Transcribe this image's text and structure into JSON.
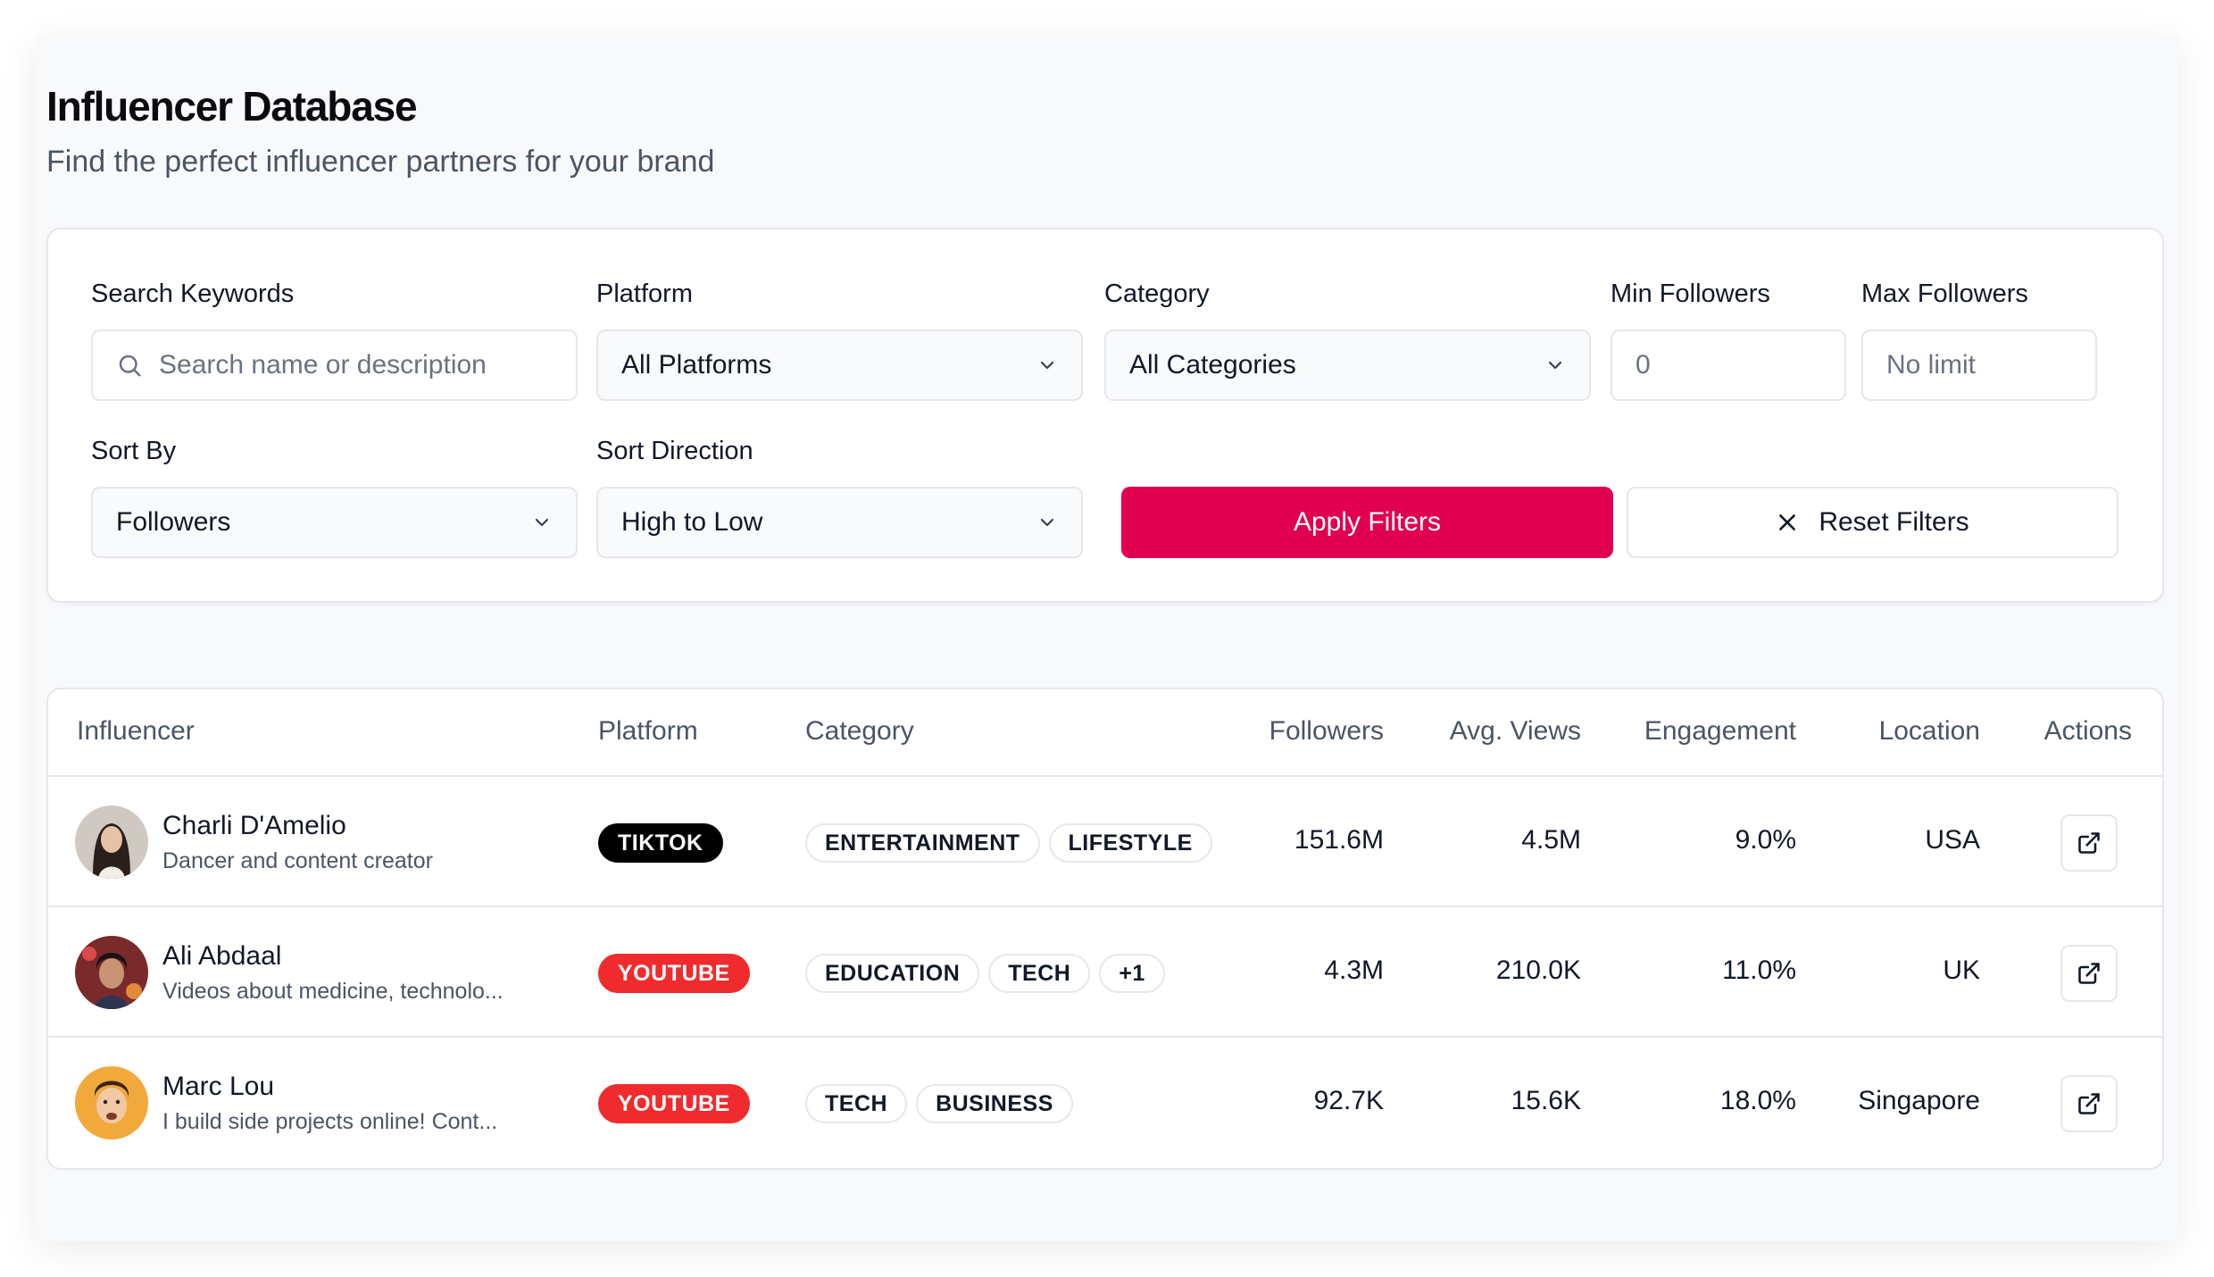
{
  "header": {
    "title": "Influencer Database",
    "subtitle": "Find the perfect influencer partners for your brand"
  },
  "filters": {
    "search": {
      "label": "Search Keywords",
      "placeholder": "Search name or description"
    },
    "platform": {
      "label": "Platform",
      "value": "All Platforms"
    },
    "category": {
      "label": "Category",
      "value": "All Categories"
    },
    "min_followers": {
      "label": "Min Followers",
      "placeholder": "0"
    },
    "max_followers": {
      "label": "Max Followers",
      "placeholder": "No limit"
    },
    "sort_by": {
      "label": "Sort By",
      "value": "Followers"
    },
    "sort_direction": {
      "label": "Sort Direction",
      "value": "High to Low"
    },
    "apply_label": "Apply Filters",
    "reset_label": "Reset Filters"
  },
  "table": {
    "headers": [
      "Influencer",
      "Platform",
      "Category",
      "Followers",
      "Avg. Views",
      "Engagement",
      "Location",
      "Actions"
    ],
    "rows": [
      {
        "name": "Charli D'Amelio",
        "description": "Dancer and content creator",
        "platform": "TIKTOK",
        "platform_color": "#000000",
        "categories": [
          "ENTERTAINMENT",
          "LIFESTYLE"
        ],
        "followers": "151.6M",
        "avg_views": "4.5M",
        "engagement": "9.0%",
        "location": "USA"
      },
      {
        "name": "Ali Abdaal",
        "description": "Videos about medicine, technolo...",
        "platform": "YOUTUBE",
        "platform_color": "#ef2b2d",
        "categories": [
          "EDUCATION",
          "TECH",
          "+1"
        ],
        "followers": "4.3M",
        "avg_views": "210.0K",
        "engagement": "11.0%",
        "location": "UK"
      },
      {
        "name": "Marc Lou",
        "description": "I build side projects online! Cont...",
        "platform": "YOUTUBE",
        "platform_color": "#ef2b2d",
        "categories": [
          "TECH",
          "BUSINESS"
        ],
        "followers": "92.7K",
        "avg_views": "15.6K",
        "engagement": "18.0%",
        "location": "Singapore"
      }
    ]
  },
  "icons": {
    "search": "search-icon",
    "dropdown": "chevron-down-icon",
    "reset": "close-icon",
    "action": "external-link-icon"
  },
  "colors": {
    "accent": "#e0004f",
    "tiktok": "#000000",
    "youtube": "#ef2b2d"
  }
}
